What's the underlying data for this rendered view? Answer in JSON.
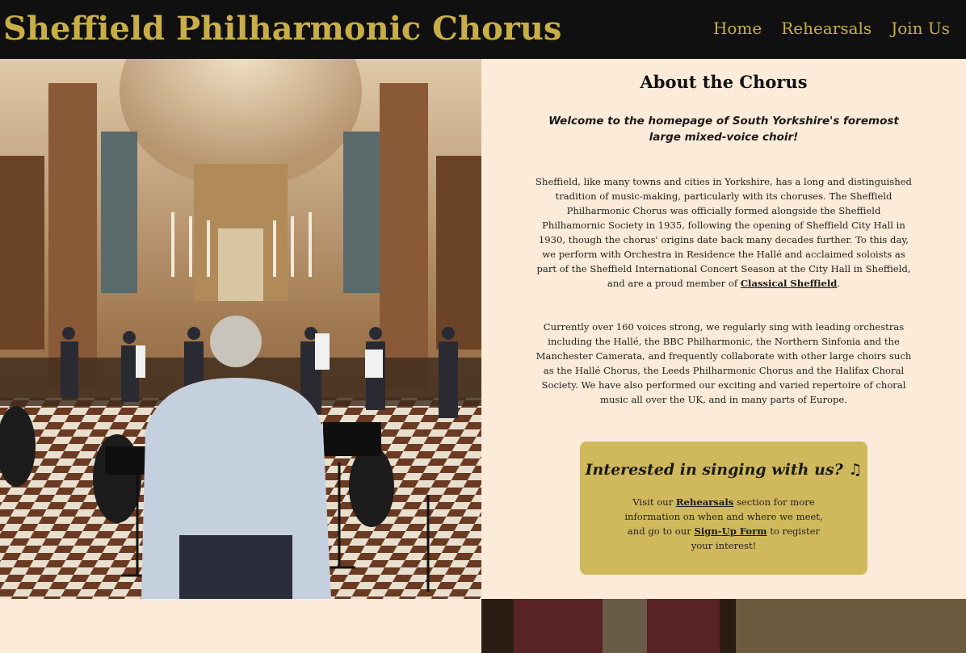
{
  "header": {
    "site_title": "Sheffield Philharmonic Chorus",
    "nav": [
      {
        "label": "Home"
      },
      {
        "label": "Rehearsals"
      },
      {
        "label": "Join Us"
      }
    ]
  },
  "about": {
    "title": "About the Chorus",
    "welcome": "Welcome to the homepage of South Yorkshire's foremost large mixed-voice choir!",
    "para1_text": "Sheffield, like many towns and cities in Yorkshire, has a long and distinguished tradition of music-making, particularly with its choruses. The Sheffield Philharmonic Chorus was officially formed alongside the Sheffield Philhamornic Society in 1935, following the opening of Sheffield City Hall in 1930, though the chorus' origins date back many decades further. To this day, we perform with Orchestra in Residence the Hallé and acclaimed soloists as part of the Sheffield International Concert Season at the City Hall in Sheffield, and are a proud member of ",
    "para1_link": "Classical Sheffield",
    "para1_end": ".",
    "para2_text": "Currently over 160 voices strong, we regularly sing with leading orchestras including the Hallé, the BBC Philharmonic, the Northern Sinfonia and the Manchester Camerata, and frequently collaborate with other large choirs such as the Hallé Chorus, the Leeds Philharmonic Chorus and the Halifax Choral Society. We have also performed our exciting and varied repertoire of choral music all over the UK, and in many parts of Europe."
  },
  "cta": {
    "title": "Interested in singing with us? ♫",
    "text_a": "Visit our ",
    "link_rehearsals": "Rehearsals",
    "text_b": " section for more information on when and where we meet, and go to our ",
    "link_signup": "Sign-Up Form",
    "text_c": " to register your interest!"
  },
  "colors": {
    "header_bg": "#101010",
    "brand_gold": "#c9ae48",
    "page_bg": "#fbebd8",
    "cta_bg": "#d0b85c"
  }
}
